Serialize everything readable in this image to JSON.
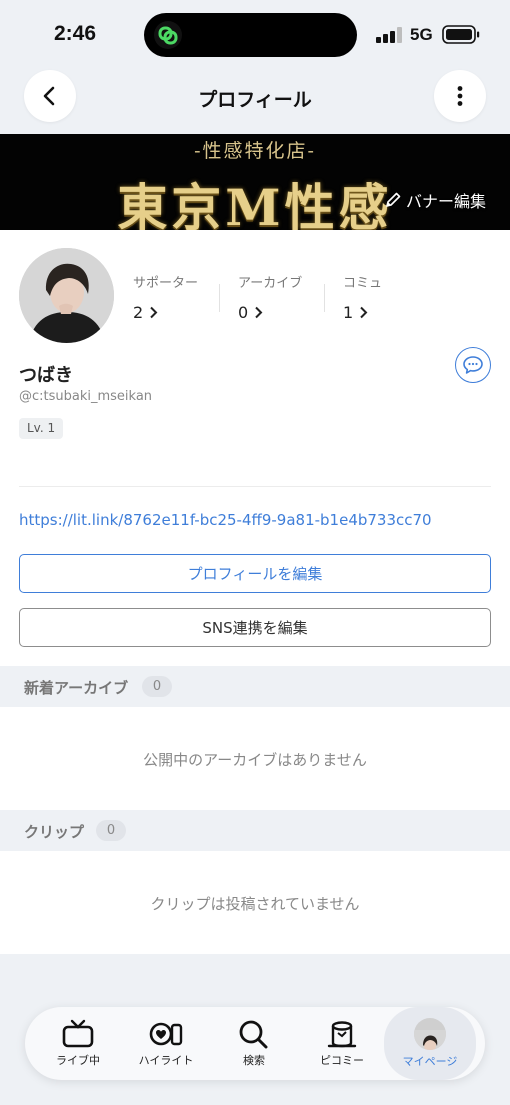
{
  "status_bar": {
    "time": "2:46",
    "network": "5G"
  },
  "nav": {
    "title": "プロフィール",
    "back_icon": "chevron-left-icon",
    "more_icon": "more-vertical-icon"
  },
  "banner": {
    "subtitle": "-性感特化店-",
    "title": "東京M性感",
    "edit_label": "バナー編集"
  },
  "profile": {
    "name": "つばき",
    "handle": "@c:tsubaki_mseikan",
    "level": "Lv. 1",
    "stats": [
      {
        "label": "サポーター",
        "value": "2"
      },
      {
        "label": "アーカイブ",
        "value": "0"
      },
      {
        "label": "コミュ",
        "value": "1"
      }
    ],
    "link": "https://lit.link/8762e11f-bc25-4ff9-9a81-b1e4b733cc70",
    "edit_profile_label": "プロフィールを編集",
    "edit_sns_label": "SNS連携を編集"
  },
  "archives": {
    "title": "新着アーカイブ",
    "count": "0",
    "empty_text": "公開中のアーカイブはありません"
  },
  "clips": {
    "title": "クリップ",
    "count": "0",
    "empty_text": "クリップは投稿されていません"
  },
  "tabs": [
    {
      "label": "ライブ中",
      "icon": "tv-icon"
    },
    {
      "label": "ハイライト",
      "icon": "highlight-icon"
    },
    {
      "label": "検索",
      "icon": "search-icon"
    },
    {
      "label": "ピコミー",
      "icon": "picomee-icon"
    },
    {
      "label": "マイページ",
      "icon": "avatar"
    }
  ],
  "colors": {
    "accent": "#3f7ed9",
    "background": "#eef1f5",
    "banner_gold": "#e6cf8a"
  }
}
